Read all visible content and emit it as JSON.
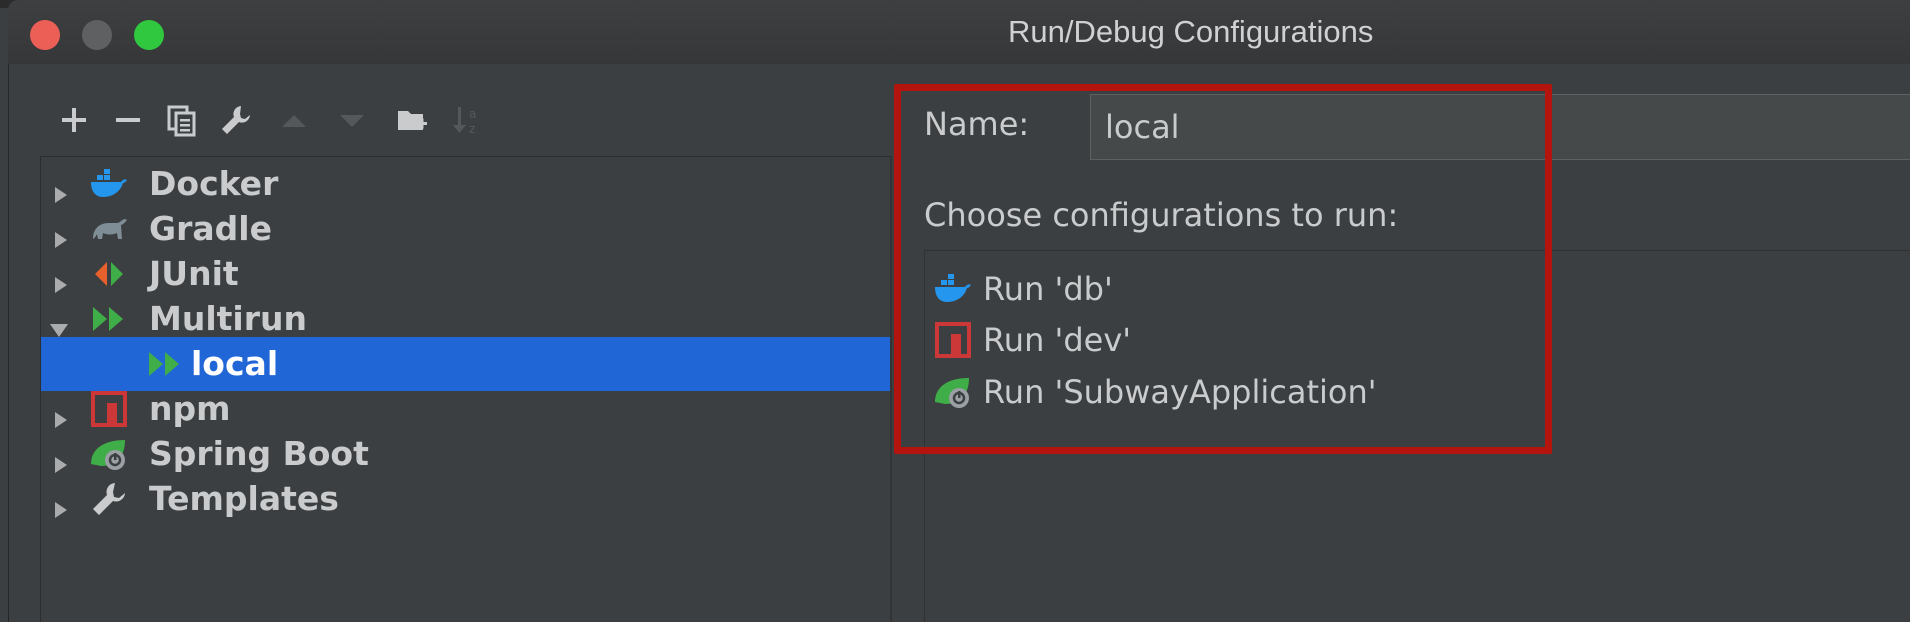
{
  "window": {
    "title": "Run/Debug Configurations"
  },
  "toolbar": {
    "buttons": [
      "plus-icon",
      "minus-icon",
      "copy-icon",
      "wrench-icon",
      "move-up-icon",
      "move-down-icon",
      "new-folder-icon",
      "sort-icon"
    ]
  },
  "tree": {
    "items": [
      {
        "label": "Docker",
        "icon": "docker-icon",
        "expanded": false
      },
      {
        "label": "Gradle",
        "icon": "gradle-icon",
        "expanded": false
      },
      {
        "label": "JUnit",
        "icon": "junit-icon",
        "expanded": false
      },
      {
        "label": "Multirun",
        "icon": "multirun-icon",
        "expanded": true
      },
      {
        "label": "local",
        "icon": "multirun-icon",
        "selected": true
      },
      {
        "label": "npm",
        "icon": "npm-icon",
        "expanded": false
      },
      {
        "label": "Spring Boot",
        "icon": "spring-boot-icon",
        "expanded": false
      },
      {
        "label": "Templates",
        "icon": "wrench-icon",
        "expanded": false
      }
    ]
  },
  "form": {
    "name_label": "Name:",
    "name_value": "local",
    "choose_label": "Choose configurations to run:",
    "configs": [
      {
        "label": "Run 'db'",
        "icon": "docker-icon"
      },
      {
        "label": "Run 'dev'",
        "icon": "npm-icon"
      },
      {
        "label": "Run 'SubwayApplication'",
        "icon": "spring-boot-icon"
      }
    ]
  },
  "colors": {
    "selection": "#2166d6",
    "highlight": "#b3140d",
    "docker": "#2496ed",
    "green": "#3fae49",
    "npm": "#cb3837"
  }
}
